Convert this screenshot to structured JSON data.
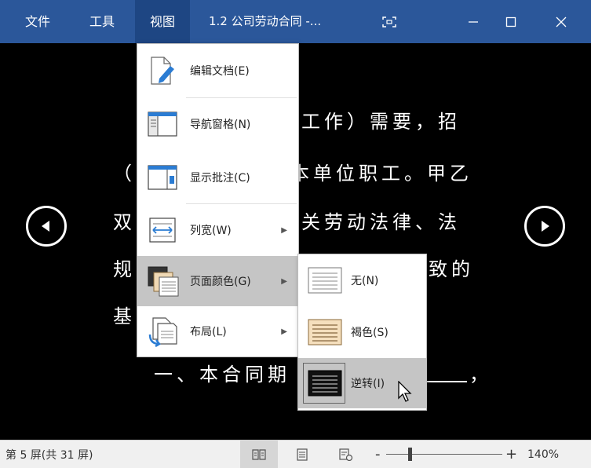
{
  "menubar": {
    "tabs": [
      {
        "label": "文件"
      },
      {
        "label": "工具"
      },
      {
        "label": "视图"
      }
    ],
    "doc_title": "1.2 公司劳动合同 -...",
    "focus_icon": "focus-mode-icon",
    "minimize_icon": "minimize-icon",
    "maximize_icon": "maximize-icon",
    "close_icon": "close-icon",
    "accent": "#2b579a"
  },
  "document": {
    "lines": [
      "工作）需要，招",
      "（",
      "本单位职工。甲乙",
      "双",
      "关劳动法律、法",
      "规",
      "致的",
      "基",
      "一、本合同期",
      "，"
    ]
  },
  "view_menu": {
    "items": [
      {
        "label": "编辑文档",
        "key": "(E)",
        "icon": "edit-document-icon"
      },
      {
        "label": "导航窗格",
        "key": "(N)",
        "icon": "navigation-pane-icon"
      },
      {
        "label": "显示批注",
        "key": "(C)",
        "icon": "show-comments-icon"
      },
      {
        "label": "列宽",
        "key": "(W)",
        "icon": "column-width-icon"
      },
      {
        "label": "页面颜色",
        "key": "(G)",
        "icon": "page-color-icon"
      },
      {
        "label": "布局",
        "key": "(L)",
        "icon": "layout-icon"
      }
    ]
  },
  "page_color_submenu": {
    "items": [
      {
        "label": "无",
        "key": "(N)",
        "icon": "page-color-none-icon"
      },
      {
        "label": "褐色",
        "key": "(S)",
        "icon": "page-color-sepia-icon"
      },
      {
        "label": "逆转",
        "key": "(I)",
        "icon": "page-color-inverse-icon"
      }
    ]
  },
  "statusbar": {
    "page_info": "第 5 屏(共 31 屏)",
    "zoom_minus": "-",
    "zoom_plus": "+",
    "zoom_level": "140%"
  }
}
